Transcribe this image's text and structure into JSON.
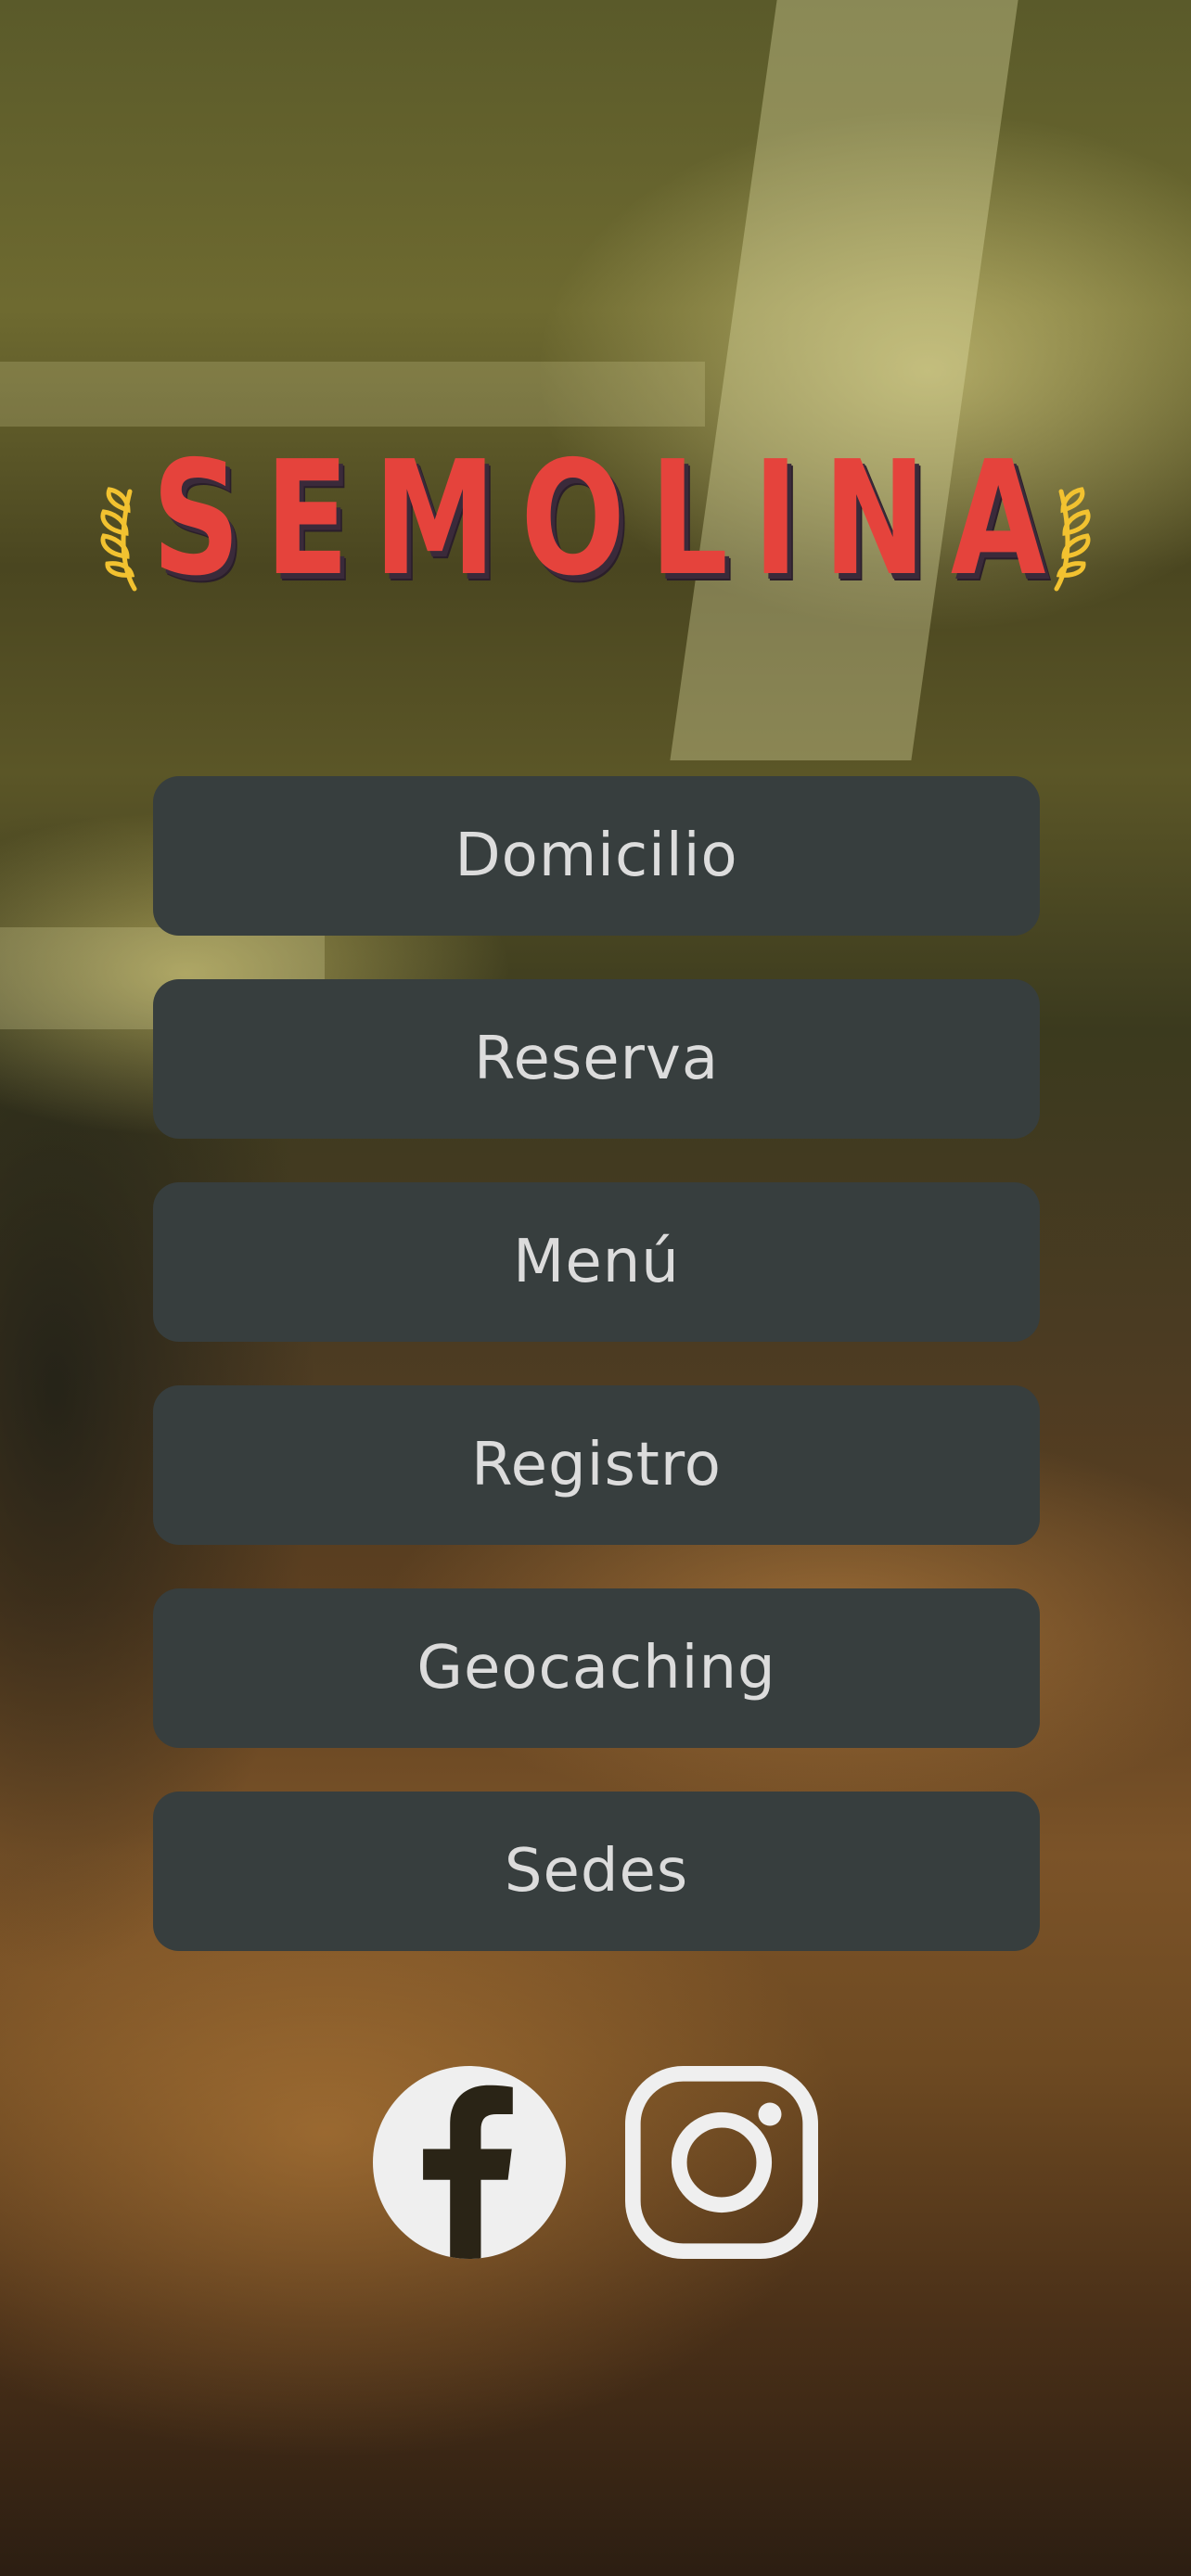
{
  "brand": {
    "name": "SEMOLINA"
  },
  "menu": {
    "items": [
      {
        "label": "Domicilio"
      },
      {
        "label": "Reserva"
      },
      {
        "label": "Menú"
      },
      {
        "label": "Registro"
      },
      {
        "label": "Geocaching"
      },
      {
        "label": "Sedes"
      }
    ]
  },
  "social": {
    "items": [
      {
        "icon": "facebook-icon"
      },
      {
        "icon": "instagram-icon"
      }
    ]
  },
  "colors": {
    "brand_red": "#e5433c",
    "button_bg": "#373e3e",
    "button_text": "#dcdcdc",
    "laurel_gold": "#f2c230",
    "icon_white": "#efefef"
  }
}
